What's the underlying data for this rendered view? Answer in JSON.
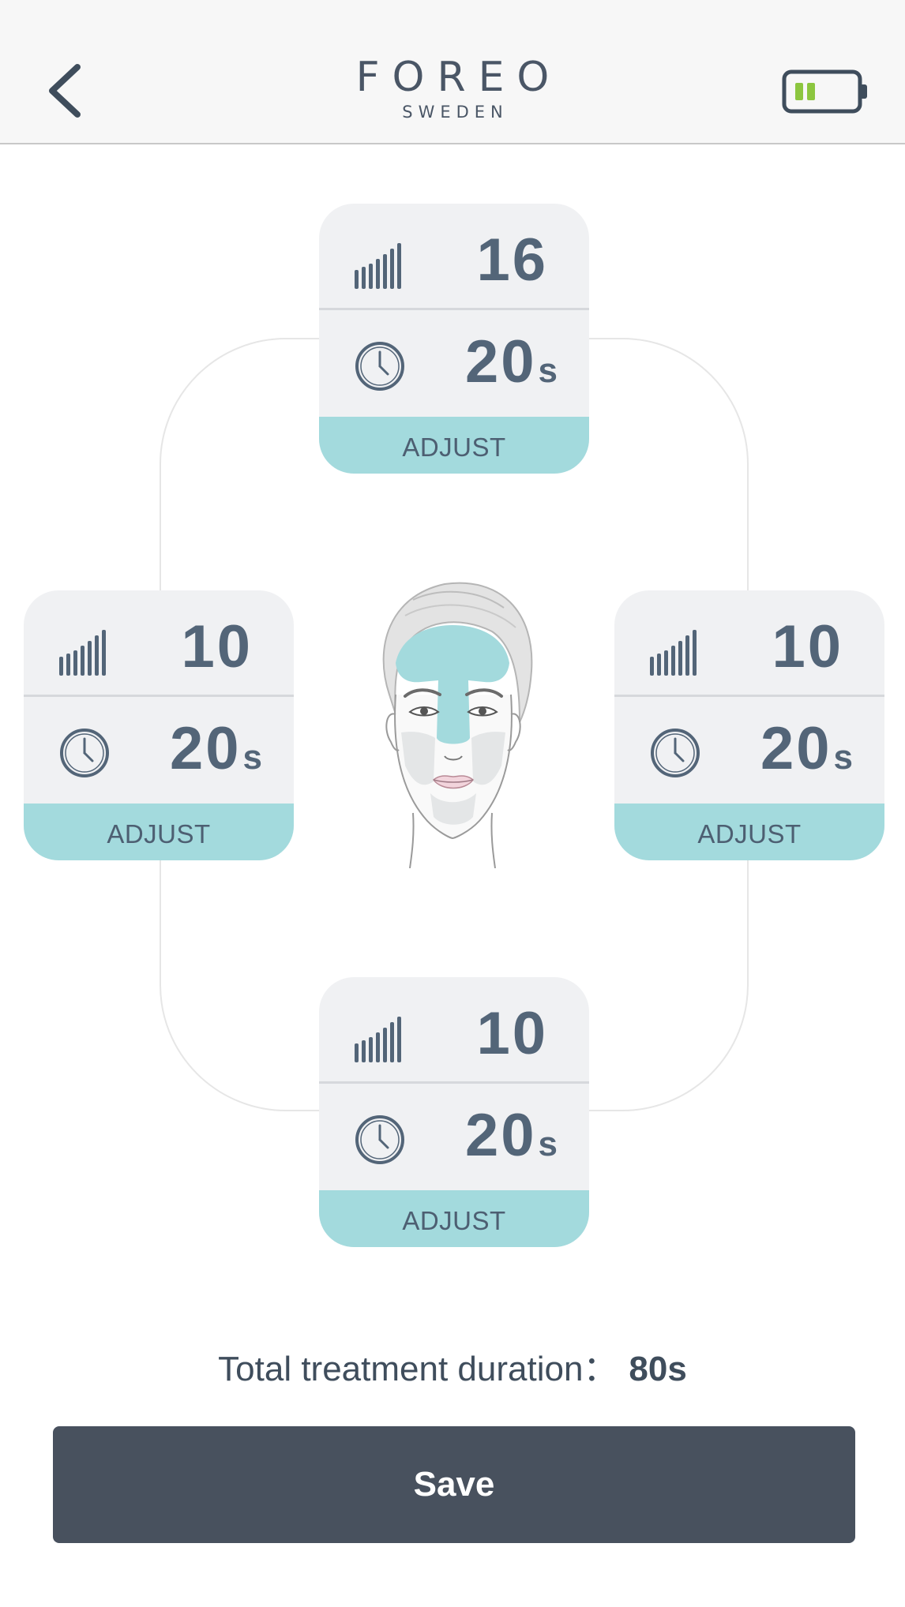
{
  "header": {
    "brand_name": "FOREO",
    "brand_sub": "SWEDEN",
    "back_icon": "chevron-left-icon",
    "battery_icon": "battery-icon",
    "battery_level": 0.4,
    "battery_color": "#8cc63f"
  },
  "zones": {
    "top": {
      "level": "16",
      "time": "20",
      "unit": "s",
      "adjust_label": "ADJUST"
    },
    "left": {
      "level": "10",
      "time": "20",
      "unit": "s",
      "adjust_label": "ADJUST"
    },
    "right": {
      "level": "10",
      "time": "20",
      "unit": "s",
      "adjust_label": "ADJUST"
    },
    "bottom": {
      "level": "10",
      "time": "20",
      "unit": "s",
      "adjust_label": "ADJUST"
    }
  },
  "icons": {
    "intensity": "signal-bars-icon",
    "timer": "clock-icon"
  },
  "summary": {
    "total_label": "Total treatment duration：",
    "total_value": "80s"
  },
  "actions": {
    "save_label": "Save"
  },
  "colors": {
    "accent": "#a3dadd",
    "text": "#536578",
    "button": "#48515e",
    "card": "#f0f1f3"
  }
}
